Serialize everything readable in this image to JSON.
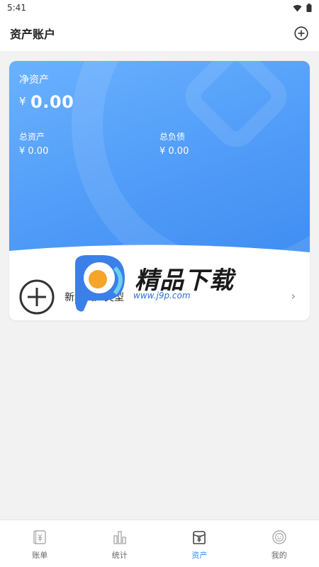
{
  "status_bar": {
    "time": "5:41"
  },
  "header": {
    "title": "资产账户"
  },
  "summary": {
    "net_assets_label": "净资产",
    "currency": "¥",
    "net_assets_value": "0.00",
    "total_assets_label": "总资产",
    "total_assets_value": "¥ 0.00",
    "total_debt_label": "总负债",
    "total_debt_value": "¥ 0.00"
  },
  "add_asset_type": {
    "label": "新增资产类型"
  },
  "watermark": {
    "brand": "精品下载",
    "url": "www.j9p.com"
  },
  "tabbar": {
    "tabs": [
      {
        "label": "账单",
        "icon": "ledger-icon",
        "active": false
      },
      {
        "label": "统计",
        "icon": "chart-bars-icon",
        "active": false
      },
      {
        "label": "资产",
        "icon": "wallet-icon",
        "active": true
      },
      {
        "label": "我的",
        "icon": "profile-face-icon",
        "active": false
      }
    ]
  },
  "colors": {
    "accent": "#3d8cf2",
    "card_top": "#6ab1ff",
    "card_bottom": "#3d8cf2"
  }
}
